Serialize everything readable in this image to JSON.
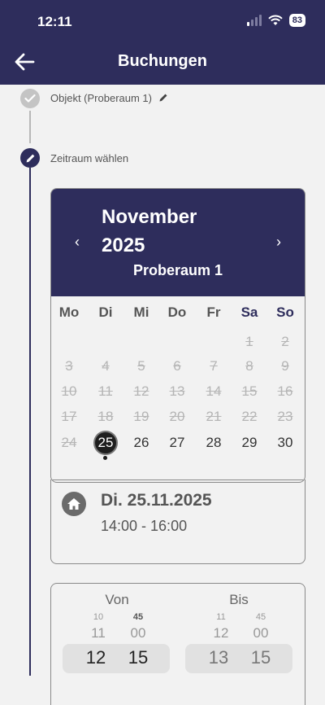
{
  "status_bar": {
    "time": "12:11",
    "battery": "83"
  },
  "header": {
    "title": "Buchungen"
  },
  "steps": [
    {
      "label": "Objekt (Proberaum 1)"
    },
    {
      "label": "Zeitraum wählen"
    }
  ],
  "calendar": {
    "month_line1": "November",
    "month_line2": "2025",
    "room": "Proberaum 1",
    "weekdays": [
      "Mo",
      "Di",
      "Mi",
      "Do",
      "Fr",
      "Sa",
      "So"
    ],
    "weeks": [
      [
        "",
        "",
        "",
        "",
        "",
        "1",
        "2"
      ],
      [
        "3",
        "4",
        "5",
        "6",
        "7",
        "8",
        "9"
      ],
      [
        "10",
        "11",
        "12",
        "13",
        "14",
        "15",
        "16"
      ],
      [
        "17",
        "18",
        "19",
        "20",
        "21",
        "22",
        "23"
      ],
      [
        "24",
        "25",
        "26",
        "27",
        "28",
        "29",
        "30"
      ]
    ],
    "selected_day": "25",
    "available_days": [
      "25",
      "26",
      "27",
      "28",
      "29",
      "30"
    ]
  },
  "booking": {
    "date": "Di. 25.11.2025",
    "time_range": "14:00 - 16:00"
  },
  "time_picker": {
    "from_label": "Von",
    "to_label": "Bis",
    "from": {
      "hours": [
        "10",
        "11",
        "12"
      ],
      "minutes": [
        "45",
        "00",
        "15"
      ]
    },
    "to": {
      "hours": [
        "11",
        "12",
        "13"
      ],
      "minutes": [
        "45",
        "00",
        "15"
      ]
    }
  }
}
